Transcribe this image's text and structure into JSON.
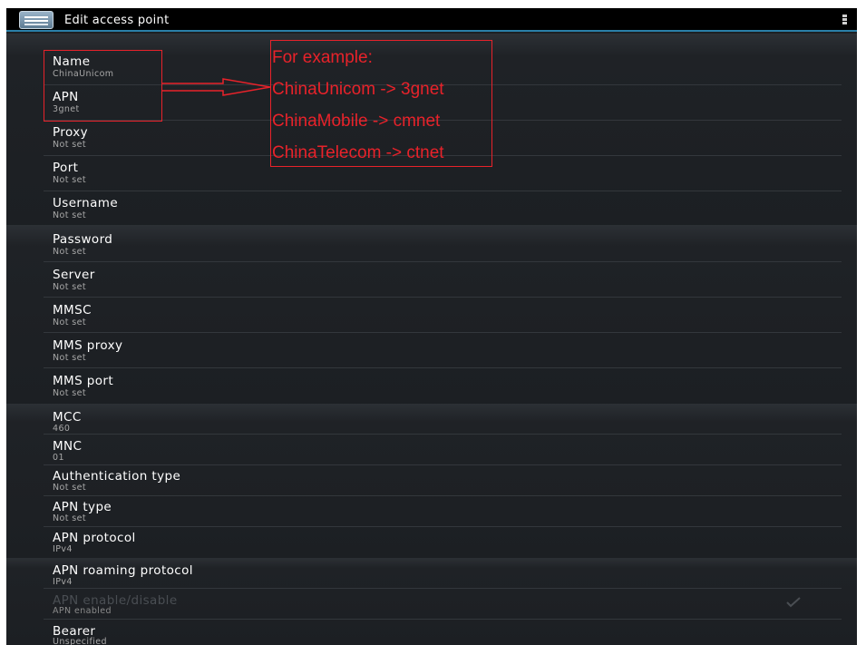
{
  "window": {
    "title": "Edit access point",
    "icon": "settings-app-icon",
    "menu_icon": "overflow-menu-icon"
  },
  "preferences": [
    {
      "title": "Name",
      "summary": "ChinaUnicom"
    },
    {
      "title": "APN",
      "summary": "3gnet"
    },
    {
      "title": "Proxy",
      "summary": "Not set"
    },
    {
      "title": "Port",
      "summary": "Not set"
    },
    {
      "title": "Username",
      "summary": "Not set"
    },
    {
      "title": "Password",
      "summary": "Not set"
    },
    {
      "title": "Server",
      "summary": "Not set"
    },
    {
      "title": "MMSC",
      "summary": "Not set"
    },
    {
      "title": "MMS proxy",
      "summary": "Not set"
    },
    {
      "title": "MMS port",
      "summary": "Not set"
    },
    {
      "title": "MCC",
      "summary": "460"
    },
    {
      "title": "MNC",
      "summary": "01"
    },
    {
      "title": "Authentication type",
      "summary": "Not set"
    },
    {
      "title": "APN type",
      "summary": "Not set"
    },
    {
      "title": "APN protocol",
      "summary": "IPv4"
    },
    {
      "title": "APN roaming protocol",
      "summary": "IPv4"
    },
    {
      "title": "APN enable/disable",
      "summary": "APN enabled",
      "checkbox": true,
      "disabled": true
    },
    {
      "title": "Bearer",
      "summary": "Unspecified"
    }
  ],
  "annotation": {
    "lines": [
      "For example:",
      "ChinaUnicom -> 3gnet",
      "ChinaMobile -> cmnet",
      "ChinaTelecom -> ctnet"
    ],
    "color": "#e8222a"
  },
  "colors": {
    "background": "#1d2024",
    "action_bar": "#000000",
    "accent": "#2a7fa8",
    "title_text": "#ffffff",
    "summary_text": "#a8a8a8"
  }
}
